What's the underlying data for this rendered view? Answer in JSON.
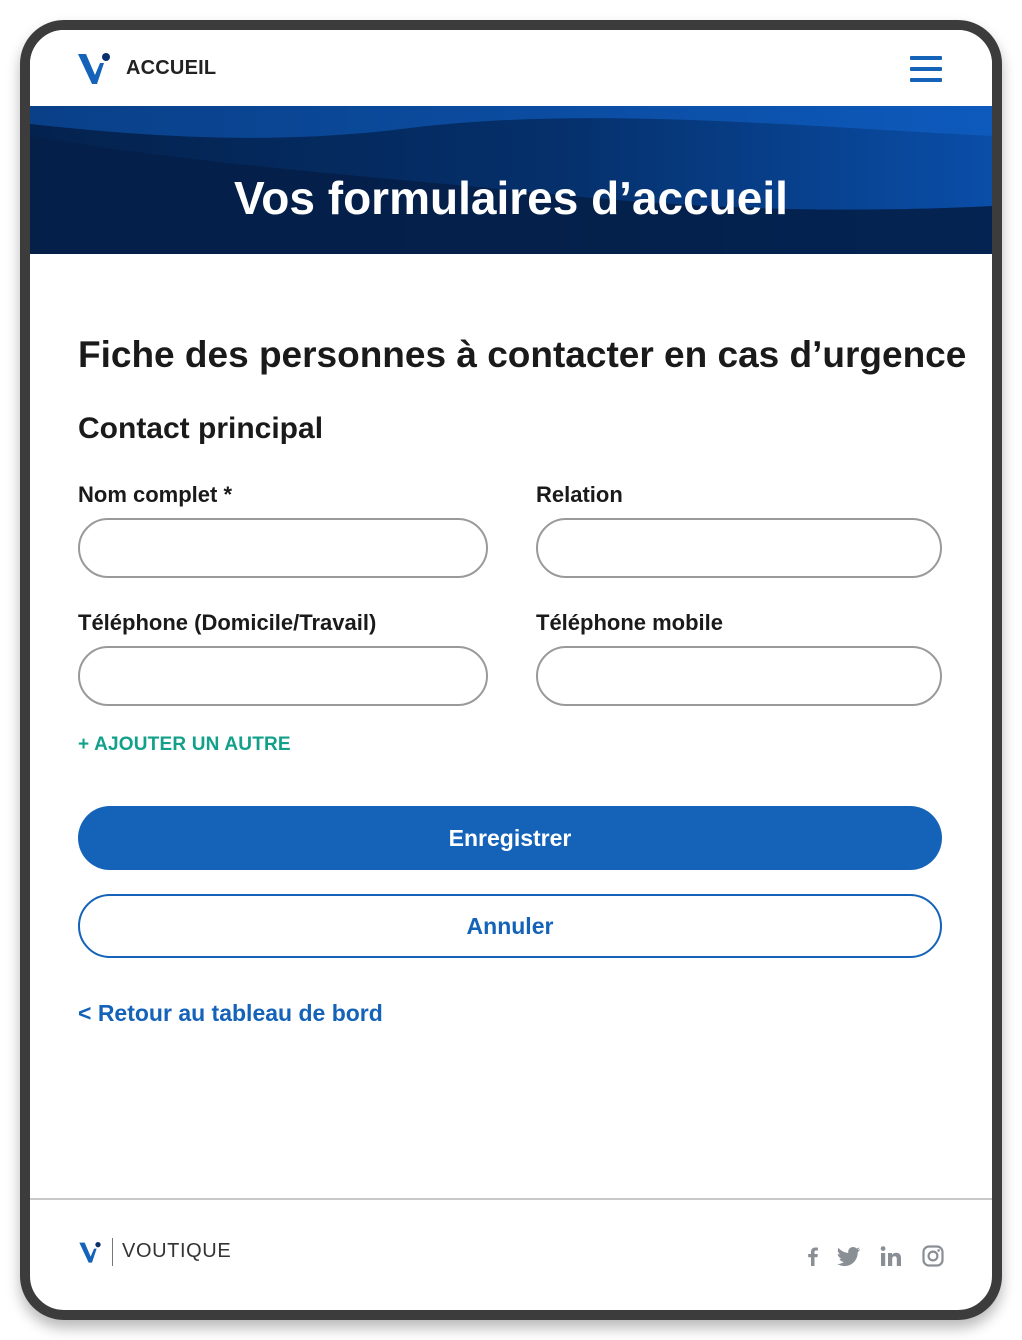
{
  "header": {
    "nav_label": "ACCUEIL"
  },
  "hero": {
    "title": "Vos formulaires d’accueil"
  },
  "form": {
    "title": "Fiche des personnes à contacter en cas d’urgence",
    "section_title": "Contact principal",
    "fields": {
      "full_name": {
        "label": "Nom complet *",
        "value": ""
      },
      "relation": {
        "label": "Relation",
        "value": ""
      },
      "phone_home_work": {
        "label": "Téléphone (Domicile/Travail)",
        "value": ""
      },
      "phone_mobile": {
        "label": "Téléphone mobile",
        "value": ""
      }
    },
    "add_another_label": "+ AJOUTER UN AUTRE",
    "save_label": "Enregistrer",
    "cancel_label": "Annuler",
    "back_label": "< Retour au tableau de bord"
  },
  "footer": {
    "brand": "VOUTIQUE",
    "social": [
      "facebook-icon",
      "twitter-icon",
      "linkedin-icon",
      "instagram-icon"
    ]
  },
  "colors": {
    "primary": "#1463b8",
    "accent_green": "#13a08b",
    "hero_dark": "#062a5f",
    "frame": "#3c3c3c"
  }
}
